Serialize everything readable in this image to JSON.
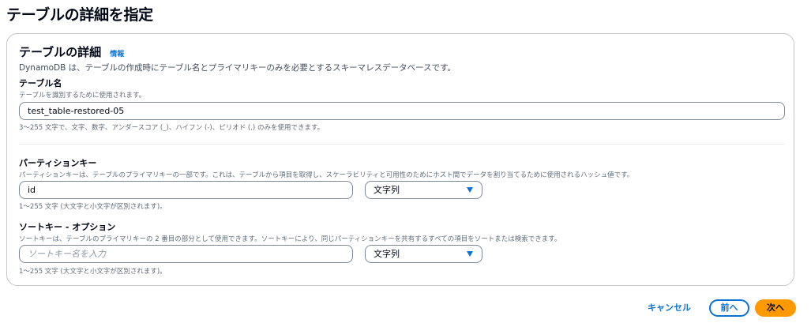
{
  "page": {
    "title": "テーブルの詳細を指定"
  },
  "panel": {
    "title": "テーブルの詳細",
    "info_link": "情報",
    "description": "DynamoDB は、テーブルの作成時にテーブル名とプライマリキーのみを必要とするスキーマレスデータベースです。"
  },
  "table_name": {
    "label": "テーブル名",
    "description": "テーブルを識別するために使用されます。",
    "value": "test_table-restored-05",
    "constraint": "3～255 文字で、文字、数字、アンダースコア (_)、ハイフン (-)、ピリオド (.) のみを使用できます。"
  },
  "partition_key": {
    "label": "パーティションキー",
    "description": "パーティションキーは、テーブルのプライマリキーの一部です。これは、テーブルから項目を取得し、スケーラビリティと可用性のためにホスト間でデータを割り当てるために使用されるハッシュ値です。",
    "value": "id",
    "type_selected": "文字列",
    "constraint": "1～255 文字 (大文字と小文字が区別されます)。"
  },
  "sort_key": {
    "label": "ソートキー - オプション",
    "description": "ソートキーは、テーブルのプライマリキーの 2 番目の部分として使用できます。ソートキーにより、同じパーティションキーを共有するすべての項目をソートまたは検索できます。",
    "value": "",
    "placeholder": "ソートキー名を入力",
    "type_selected": "文字列",
    "constraint": "1～255 文字 (大文字と小文字が区別されます)。"
  },
  "actions": {
    "cancel": "キャンセル",
    "previous": "前へ",
    "next": "次へ"
  },
  "colors": {
    "link": "#0972d3",
    "primary_button": "#ff9900",
    "border": "#7d8998"
  }
}
